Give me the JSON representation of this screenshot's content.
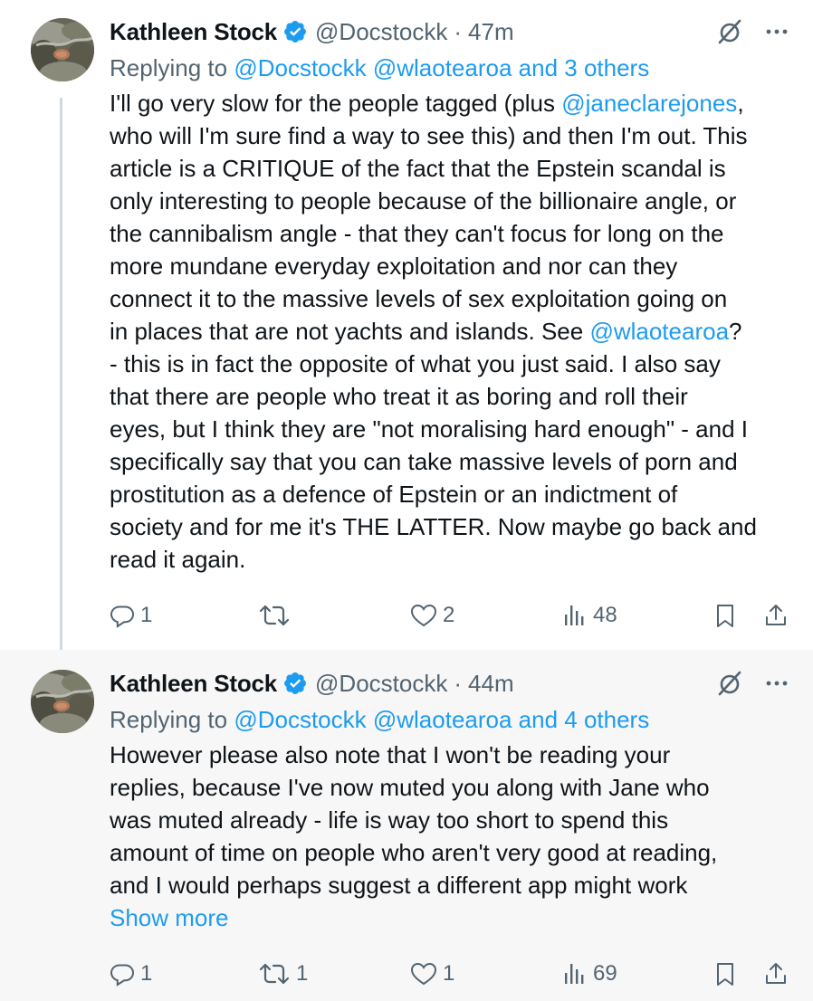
{
  "tweets": [
    {
      "author_name": "Kathleen Stock",
      "handle": "@Docstockk",
      "separator": "·",
      "time": "47m",
      "replying_prefix": "Replying to",
      "replying_mentions": "@Docstockk @wlaotearoa and 3 others",
      "text_lines": [
        [
          "I'll go very slow for the people tagged (plus ",
          "@janeclarejones",
          ","
        ],
        [
          "who will I'm sure find a way to see this) and then I'm out. This"
        ],
        [
          "article is a CRITIQUE of the fact that the Epstein scandal is"
        ],
        [
          "only interesting to people because of the billionaire angle, or"
        ],
        [
          "the cannibalism angle - that they can't focus for long on the"
        ],
        [
          "more mundane everyday exploitation and nor can they"
        ],
        [
          "connect it to the massive levels  of sex exploitation going on"
        ],
        [
          "in places that are not yachts and islands. See ",
          "@wlaotearoa",
          "?"
        ],
        [
          "- this is in fact the opposite of what you just said.  I also say"
        ],
        [
          "that there are people who treat it as boring and roll their"
        ],
        [
          "eyes, but I think they are \"not moralising hard enough\" - and I"
        ],
        [
          "specifically say that you can take massive levels of porn and"
        ],
        [
          "prostitution as a defence of Epstein or an indictment of"
        ],
        [
          "society and for me it's THE LATTER. Now maybe go back and"
        ],
        [
          "read it again."
        ]
      ],
      "show_more": "",
      "actions": {
        "reply_count": "1",
        "retweet_count": "",
        "like_count": "2",
        "views_count": "48"
      }
    },
    {
      "author_name": "Kathleen Stock",
      "handle": "@Docstockk",
      "separator": "·",
      "time": "44m",
      "replying_prefix": "Replying to",
      "replying_mentions": "@Docstockk @wlaotearoa and 4 others",
      "text_lines": [
        [
          "However please also note that I won't be reading your"
        ],
        [
          "replies, because I've now muted you along with Jane who"
        ],
        [
          "was muted already - life is way too short to spend this"
        ],
        [
          "amount of time on people who aren't very good at reading,"
        ],
        [
          "and I would perhaps suggest a different app might work"
        ]
      ],
      "show_more": "Show more",
      "actions": {
        "reply_count": "1",
        "retweet_count": "1",
        "like_count": "1",
        "views_count": "69"
      }
    }
  ],
  "colors": {
    "accent": "#1d9bf0",
    "text_primary": "#0f1419",
    "text_secondary": "#536471",
    "thread_line": "#cfd9de",
    "highlight_background": "#f7f7f7"
  },
  "icons": {
    "verified": "verified-badge-icon",
    "mute": "mute-icon",
    "more": "more-options-icon",
    "reply": "reply-icon",
    "retweet": "retweet-icon",
    "like": "like-icon",
    "views": "views-icon",
    "bookmark": "bookmark-icon",
    "share": "share-icon"
  }
}
